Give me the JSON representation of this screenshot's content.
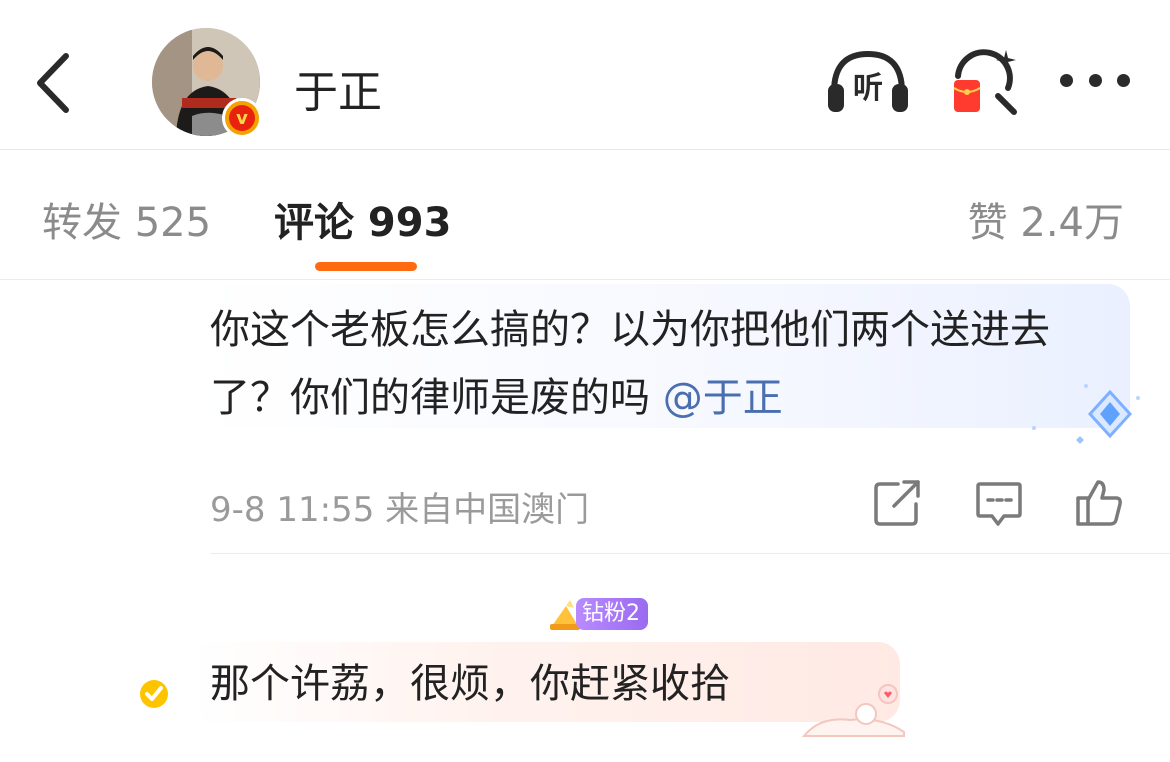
{
  "header": {
    "back_icon": "chevron-left-icon",
    "name": "于正",
    "listen_label": "听",
    "redpacket_icon": "red-packet-search-icon",
    "more_icon": "more-dots-icon"
  },
  "tabs": {
    "repost": "转发 525",
    "comment": "评论 993",
    "like": "赞 2.4万",
    "active_color": "#ff6b12"
  },
  "comments": [
    {
      "text": "你这个老板怎么搞的？以为你把他们两个送进去了？你们的律师是废的吗 ",
      "mention": "@于正",
      "meta": "9-8 11:55 来自中国澳门",
      "actions": [
        "share-icon",
        "comment-icon",
        "like-icon"
      ]
    },
    {
      "fan_badge": "钻粉2",
      "text": "那个许荔，很烦，你赶紧收拾"
    }
  ]
}
